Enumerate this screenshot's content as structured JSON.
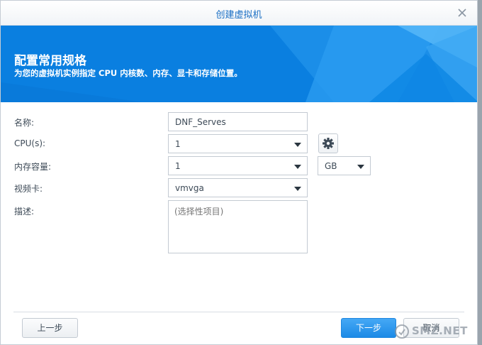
{
  "window": {
    "title": "创建虚拟机"
  },
  "banner": {
    "title": "配置常用规格",
    "subtitle": "为您的虚拟机实例指定 CPU 内核数、内存、显卡和存储位置。"
  },
  "form": {
    "name": {
      "label": "名称:",
      "value": "DNF_Serves"
    },
    "cpu": {
      "label": "CPU(s):",
      "value": "1"
    },
    "memory": {
      "label": "内存容量:",
      "value": "1",
      "unit": "GB"
    },
    "video_card": {
      "label": "视频卡:",
      "value": "vmvga"
    },
    "description": {
      "label": "描述:",
      "placeholder": "(选择性项目)"
    }
  },
  "footer": {
    "prev_label": "上一步",
    "next_label": "下一步",
    "cancel_label": "取消"
  },
  "watermark": {
    "text": "SMZ.NET"
  },
  "icons": {
    "close": "close-icon",
    "gear": "gear-icon",
    "dropdown": "chevron-down-icon"
  },
  "colors": {
    "accent": "#0a7fe0",
    "title_text": "#1a6fc4",
    "primary_button": "#1c8ae6"
  }
}
